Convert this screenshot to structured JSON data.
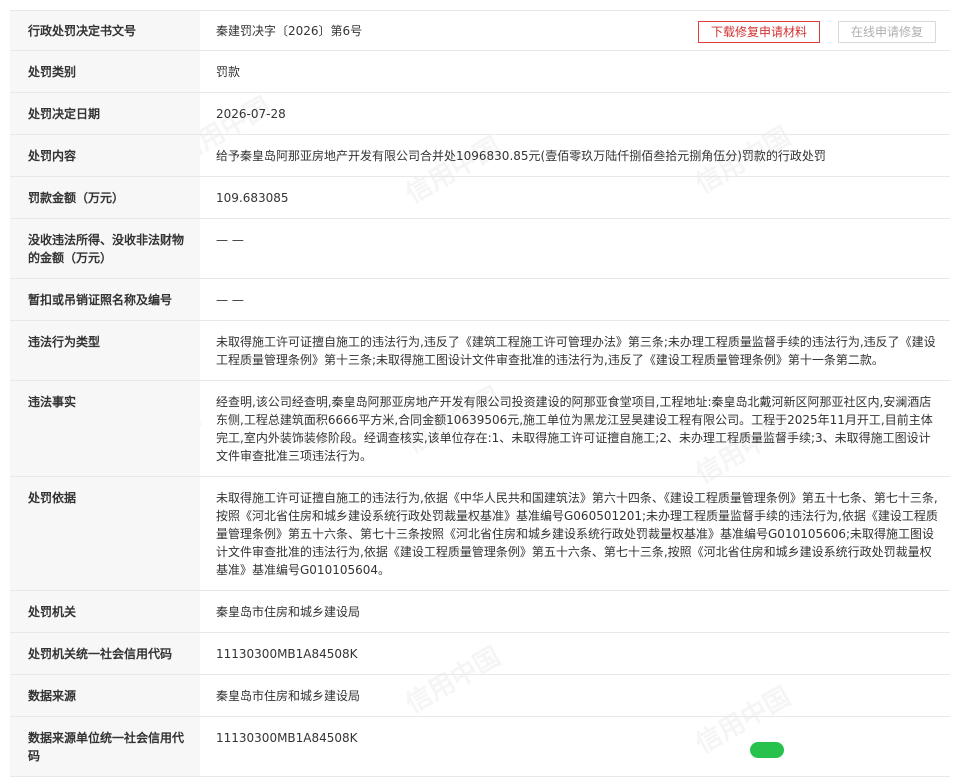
{
  "rows": [
    {
      "label": "行政处罚决定书文号",
      "value": "秦建罚决字〔2026〕第6号"
    },
    {
      "label": "处罚类别",
      "value": "罚款"
    },
    {
      "label": "处罚决定日期",
      "value": "2026-07-28"
    },
    {
      "label": "处罚内容",
      "value": "给予秦皇岛阿那亚房地产开发有限公司合并处1096830.85元(壹佰零玖万陆仟捌佰叁拾元捌角伍分)罚款的行政处罚"
    },
    {
      "label": "罚款金额（万元）",
      "value": "109.683085"
    },
    {
      "label": "没收违法所得、没收非法财物的金额（万元）",
      "value": "— —"
    },
    {
      "label": "暂扣或吊销证照名称及编号",
      "value": "— —"
    },
    {
      "label": "违法行为类型",
      "value": "未取得施工许可证擅自施工的违法行为,违反了《建筑工程施工许可管理办法》第三条;未办理工程质量监督手续的违法行为,违反了《建设工程质量管理条例》第十三条;未取得施工图设计文件审查批准的违法行为,违反了《建设工程质量管理条例》第十一条第二款。"
    },
    {
      "label": "违法事实",
      "value": "经查明,该公司经查明,秦皇岛阿那亚房地产开发有限公司投资建设的阿那亚食堂项目,工程地址:秦皇岛北戴河新区阿那亚社区内,安澜酒店东侧,工程总建筑面积6666平方米,合同金额10639506元,施工单位为黑龙江昱昊建设工程有限公司。工程于2025年11月开工,目前主体完工,室内外装饰装修阶段。经调查核实,该单位存在:1、未取得施工许可证擅自施工;2、未办理工程质量监督手续;3、未取得施工图设计文件审查批准三项违法行为。"
    },
    {
      "label": "处罚依据",
      "value": "未取得施工许可证擅自施工的违法行为,依据《中华人民共和国建筑法》第六十四条、《建设工程质量管理条例》第五十七条、第七十三条,按照《河北省住房和城乡建设系统行政处罚裁量权基准》基准编号G060501201;未办理工程质量监督手续的违法行为,依据《建设工程质量管理条例》第五十六条、第七十三条按照《河北省住房和城乡建设系统行政处罚裁量权基准》基准编号G010105606;未取得施工图设计文件审查批准的违法行为,依据《建设工程质量管理条例》第五十六条、第七十三条,按照《河北省住房和城乡建设系统行政处罚裁量权基准》基准编号G010105604。"
    },
    {
      "label": "处罚机关",
      "value": "秦皇岛市住房和城乡建设局"
    },
    {
      "label": "处罚机关统一社会信用代码",
      "value": "11130300MB1A84508K"
    },
    {
      "label": "数据来源",
      "value": "秦皇岛市住房和城乡建设局"
    },
    {
      "label": "数据来源单位统一社会信用代码",
      "value": "11130300MB1A84508K"
    }
  ],
  "buttons": {
    "download": "下载修复申请材料",
    "online": "在线申请修复"
  },
  "watermark_text": "信用中国",
  "colors": {
    "download_red": "#d33131",
    "label_bg": "#f7f7f7",
    "border": "#e8e8e8"
  }
}
